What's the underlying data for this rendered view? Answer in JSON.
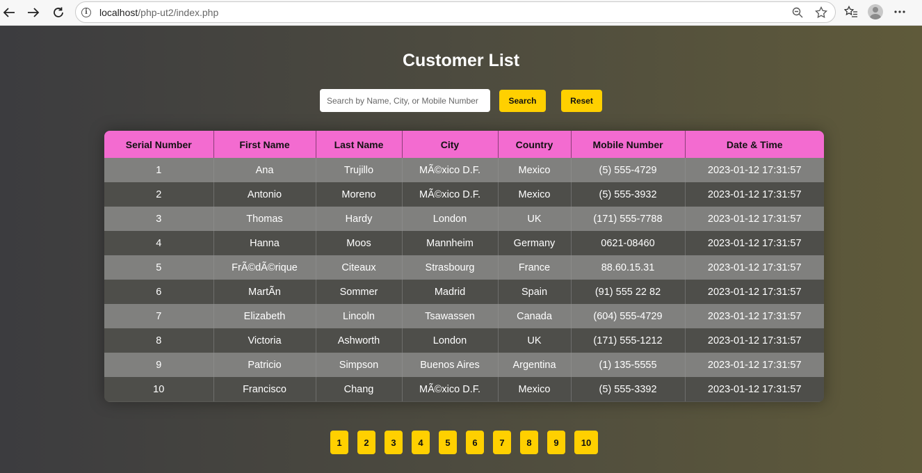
{
  "browser": {
    "url_host": "localhost",
    "url_path": "/php-ut2/index.php"
  },
  "page": {
    "title": "Customer List",
    "search": {
      "placeholder": "Search by Name, City, or Mobile Number",
      "value": "",
      "search_label": "Search",
      "reset_label": "Reset"
    },
    "table": {
      "headers": [
        "Serial Number",
        "First Name",
        "Last Name",
        "City",
        "Country",
        "Mobile Number",
        "Date & Time"
      ],
      "rows": [
        [
          "1",
          "Ana",
          "Trujillo",
          "MÃ©xico D.F.",
          "Mexico",
          "(5) 555-4729",
          "2023-01-12 17:31:57"
        ],
        [
          "2",
          "Antonio",
          "Moreno",
          "MÃ©xico D.F.",
          "Mexico",
          "(5) 555-3932",
          "2023-01-12 17:31:57"
        ],
        [
          "3",
          "Thomas",
          "Hardy",
          "London",
          "UK",
          "(171) 555-7788",
          "2023-01-12 17:31:57"
        ],
        [
          "4",
          "Hanna",
          "Moos",
          "Mannheim",
          "Germany",
          "0621-08460",
          "2023-01-12 17:31:57"
        ],
        [
          "5",
          "FrÃ©dÃ©rique",
          "Citeaux",
          "Strasbourg",
          "France",
          "88.60.15.31",
          "2023-01-12 17:31:57"
        ],
        [
          "6",
          "MartÃn",
          "Sommer",
          "Madrid",
          "Spain",
          "(91) 555 22 82",
          "2023-01-12 17:31:57"
        ],
        [
          "7",
          "Elizabeth",
          "Lincoln",
          "Tsawassen",
          "Canada",
          "(604) 555-4729",
          "2023-01-12 17:31:57"
        ],
        [
          "8",
          "Victoria",
          "Ashworth",
          "London",
          "UK",
          "(171) 555-1212",
          "2023-01-12 17:31:57"
        ],
        [
          "9",
          "Patricio",
          "Simpson",
          "Buenos Aires",
          "Argentina",
          "(1) 135-5555",
          "2023-01-12 17:31:57"
        ],
        [
          "10",
          "Francisco",
          "Chang",
          "MÃ©xico D.F.",
          "Mexico",
          "(5) 555-3392",
          "2023-01-12 17:31:57"
        ]
      ]
    },
    "pagination": [
      "1",
      "2",
      "3",
      "4",
      "5",
      "6",
      "7",
      "8",
      "9",
      "10"
    ]
  },
  "colors": {
    "header_pink": "#f36bd0",
    "button_yellow": "#ffd000"
  },
  "icons": [
    "back-arrow-icon",
    "forward-arrow-icon",
    "reload-icon",
    "info-icon",
    "zoom-out-icon",
    "star-icon",
    "favorites-icon",
    "avatar-icon",
    "more-icon"
  ]
}
